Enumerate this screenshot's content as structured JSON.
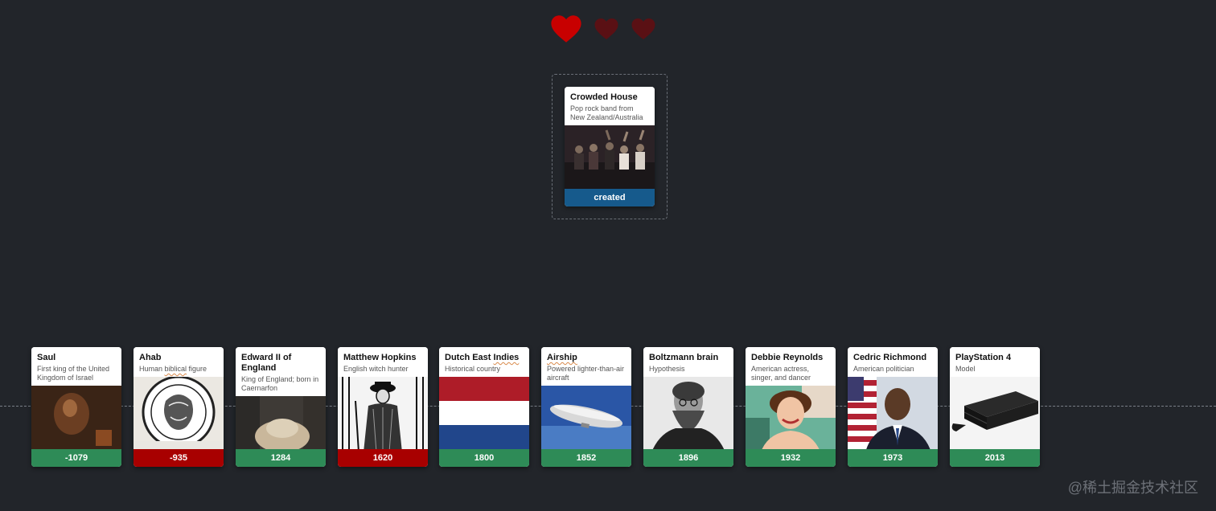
{
  "lives": {
    "total": 3,
    "remaining": 1,
    "active_color": "#c80000",
    "lost_color": "#5a1014"
  },
  "current_card": {
    "title": "Crowded House",
    "description": "Pop rock band from New Zealand/Australia",
    "label": "created",
    "image_icon": "band-photo"
  },
  "timeline": [
    {
      "title": "Saul",
      "description": "First king of the United Kingdom of Israel",
      "year": "-1079",
      "correct": true,
      "image_icon": "painting-portrait"
    },
    {
      "title": "Ahab",
      "description": "Human biblical figure",
      "year": "-935",
      "correct": false,
      "image_icon": "coin-engraving"
    },
    {
      "title": "Edward II of England",
      "description": "King of England; born in Caernarfon",
      "year": "1284",
      "correct": true,
      "image_icon": "tomb-effigy"
    },
    {
      "title": "Matthew Hopkins",
      "description": "English witch hunter",
      "year": "1620",
      "correct": false,
      "image_icon": "woodcut-figure"
    },
    {
      "title": "Dutch East Indies",
      "description": "Historical country",
      "year": "1800",
      "correct": true,
      "image_icon": "flag"
    },
    {
      "title": "Airship",
      "description": "Powered lighter-than-air aircraft",
      "year": "1852",
      "correct": true,
      "image_icon": "zeppelin"
    },
    {
      "title": "Boltzmann brain",
      "description": "Hypothesis",
      "year": "1896",
      "correct": true,
      "image_icon": "portrait-photo"
    },
    {
      "title": "Debbie Reynolds",
      "description": "American actress, singer, and dancer",
      "year": "1932",
      "correct": true,
      "image_icon": "portrait-photo"
    },
    {
      "title": "Cedric Richmond",
      "description": "American politician",
      "year": "1973",
      "correct": true,
      "image_icon": "portrait-photo"
    },
    {
      "title": "PlayStation 4",
      "description": "Model",
      "year": "2013",
      "correct": true,
      "image_icon": "game-console"
    }
  ],
  "watermark": "@稀土掘金技术社区"
}
